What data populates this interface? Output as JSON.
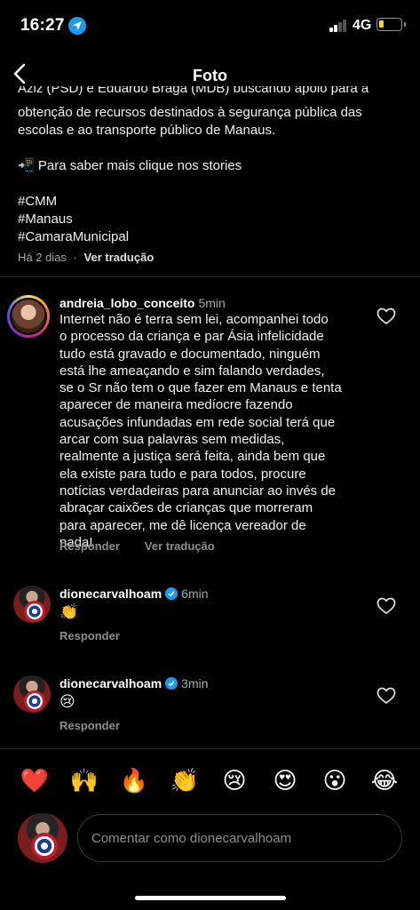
{
  "status_bar": {
    "time": "16:27",
    "network": "4G",
    "battery_color": "#ffd60a",
    "location_icon": "location-arrow-icon"
  },
  "header": {
    "title": "Foto",
    "back_icon": "chevron-left-icon"
  },
  "caption": {
    "partial_line": "Aziz (PSD) e Eduardo Braga (MDB) buscando apoio para a",
    "lines": [
      "obtenção de recursos destinados à segurança pública das",
      "escolas e ao transporte público de Manaus."
    ],
    "stories_emoji": "📲",
    "stories_line": "Para saber mais clique nos stories",
    "hashtags": [
      "#CMM",
      "#Manaus",
      "#CamaraMunicipal"
    ],
    "time_ago": "Há 2 dias",
    "separator": "·",
    "translate": "Ver tradução"
  },
  "comments": [
    {
      "username": "andreia_lobo_conceito",
      "time_ago": "5min",
      "lines": [
        "Internet não é terra sem lei, acompanhei todo",
        "o processo da criança  e par Ásia infelicidade",
        "tudo está gravado e documentado, ninguém",
        "está lhe ameaçando e sim falando verdades,",
        "se o Sr não tem o que fazer em Manaus e tenta",
        "aparecer de maneira medíocre fazendo",
        "acusações infundadas em rede social terá que",
        "arcar com sua palavras sem medidas,",
        "realmente a justiça será feita, ainda bem que",
        "ela existe para tudo e para todos, procure",
        "notícias verdadeiras para anunciar ao invés de",
        "abraçar caixões de crianças que morreram",
        "para aparecer, me dê licença vereador de",
        "nada!"
      ],
      "reply": "Responder",
      "translate": "Ver tradução"
    },
    {
      "username": "dionecarvalhoam",
      "verified": true,
      "time_ago": "6min",
      "text": "👏",
      "reply": "Responder"
    },
    {
      "username": "dionecarvalhoam",
      "verified": true,
      "time_ago": "3min",
      "text": "😢",
      "reply": "Responder"
    }
  ],
  "emoji_bar": [
    "❤️",
    "🙌",
    "🔥",
    "👏",
    "😢",
    "😍",
    "😮",
    "😂"
  ],
  "composer": {
    "placeholder": "Comentar como dionecarvalhoam"
  }
}
